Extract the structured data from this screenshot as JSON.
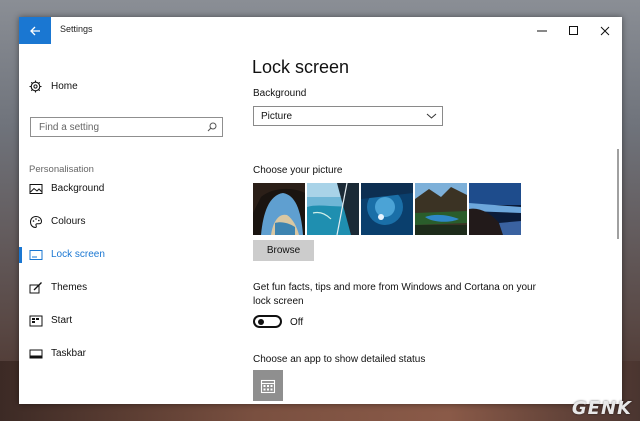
{
  "window": {
    "title": "Settings",
    "controls": {
      "minimize": "minimize-icon",
      "maximize": "maximize-icon",
      "close": "close-icon"
    },
    "accent": "#1a77d2"
  },
  "sidebar": {
    "home_label": "Home",
    "search_placeholder": "Find a setting",
    "section_label": "Personalisation",
    "items": [
      {
        "label": "Background",
        "icon": "picture-icon"
      },
      {
        "label": "Colours",
        "icon": "palette-icon"
      },
      {
        "label": "Lock screen",
        "icon": "lock-screen-icon",
        "active": true
      },
      {
        "label": "Themes",
        "icon": "brush-icon"
      },
      {
        "label": "Start",
        "icon": "start-icon"
      },
      {
        "label": "Taskbar",
        "icon": "taskbar-icon"
      }
    ]
  },
  "main": {
    "page_title": "Lock screen",
    "background_label": "Background",
    "background_value": "Picture",
    "choose_label": "Choose your picture",
    "browse_label": "Browse",
    "fun_facts_label": "Get fun facts, tips and more from Windows and Cortana on your lock screen",
    "toggle_state": "Off",
    "detailed_status_label": "Choose an app to show detailed status",
    "detailed_status_app_icon": "calendar-icon"
  },
  "watermark": "GENK"
}
